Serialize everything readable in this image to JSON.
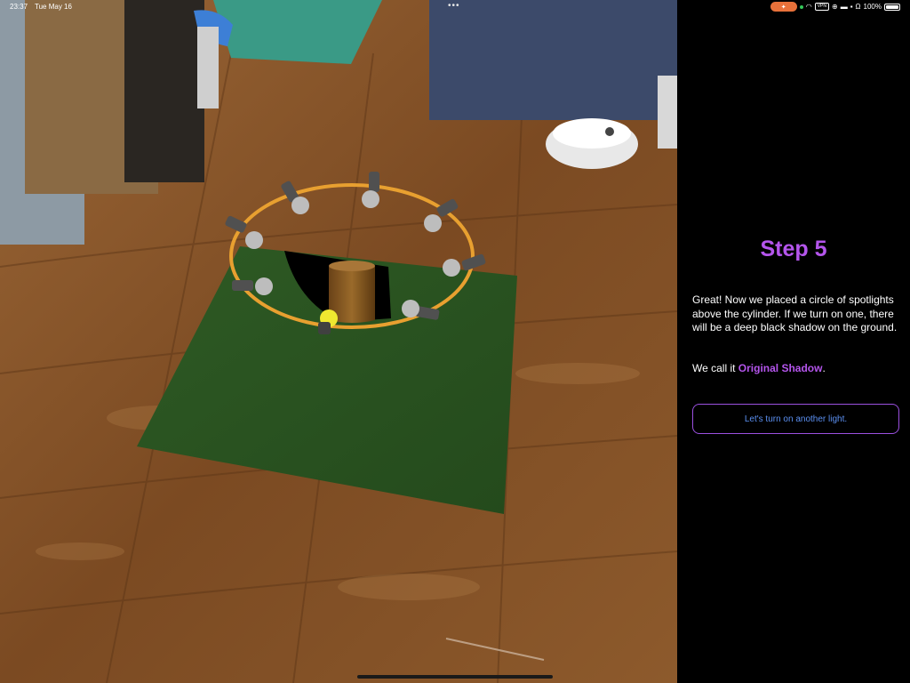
{
  "status_bar": {
    "time": "23:37",
    "date": "Tue May 16",
    "multitask_dots": "•••",
    "vpn": "VPN",
    "battery": "100%"
  },
  "instructions": {
    "title": "Step 5",
    "body": "Great! Now we placed a circle of spotlights above the cylinder. If we turn on one, there will be a deep black shadow on the ground.",
    "call_prefix": "We call it ",
    "call_term": "Original Shadow",
    "call_suffix": ".",
    "button_label": "Let's turn on another light."
  },
  "colors": {
    "accent_purple": "#b455ec",
    "button_text_blue": "#5b8ff0",
    "ring_orange": "#e8a030"
  }
}
